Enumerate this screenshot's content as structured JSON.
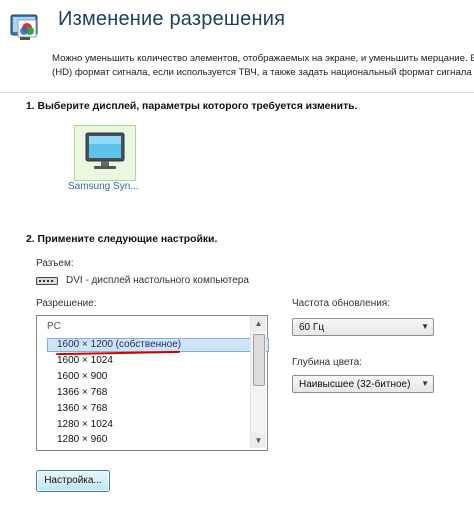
{
  "header": {
    "title": "Изменение разрешения",
    "description_line1": "Можно уменьшить количество элементов, отображаемых на экране, и уменьшить мерцание. Вы",
    "description_line2": "(HD) формат сигнала, если используется ТВЧ, а также задать национальный формат сигнала"
  },
  "step1": {
    "label": "1. Выберите дисплей, параметры которого требуется изменить.",
    "display_name": "Samsung Syn..."
  },
  "step2": {
    "label": "2. Примените следующие настройки.",
    "connector_label": "Разъем:",
    "connector_value": "DVI - дисплей настольного компьютера",
    "resolution_label": "Разрешение:",
    "resolution_group": "PC",
    "resolutions": [
      "1600 × 1200 (собственное)",
      "1600 × 1024",
      "1600 × 900",
      "1366 × 768",
      "1360 × 768",
      "1280 × 1024",
      "1280 × 960"
    ],
    "selected_resolution": "1600 × 1200 (собственное)",
    "refresh_label": "Частота обновления:",
    "refresh_value": "60 Гц",
    "depth_label": "Глубина цвета:",
    "depth_value": "Наивысшее (32-битное)",
    "settings_button": "Настройка..."
  },
  "icons": {
    "header_icon": "display-settings-icon",
    "monitor": "monitor-icon",
    "connector": "dvi-connector-icon",
    "dropdown": "chevron-down-icon",
    "scroll_up": "scroll-up-icon",
    "scroll_down": "scroll-down-icon"
  },
  "colors": {
    "title": "#1f3f66",
    "selection": "#cfe3fb",
    "annotation": "#d40000",
    "display_highlight": "#e9f8de"
  }
}
